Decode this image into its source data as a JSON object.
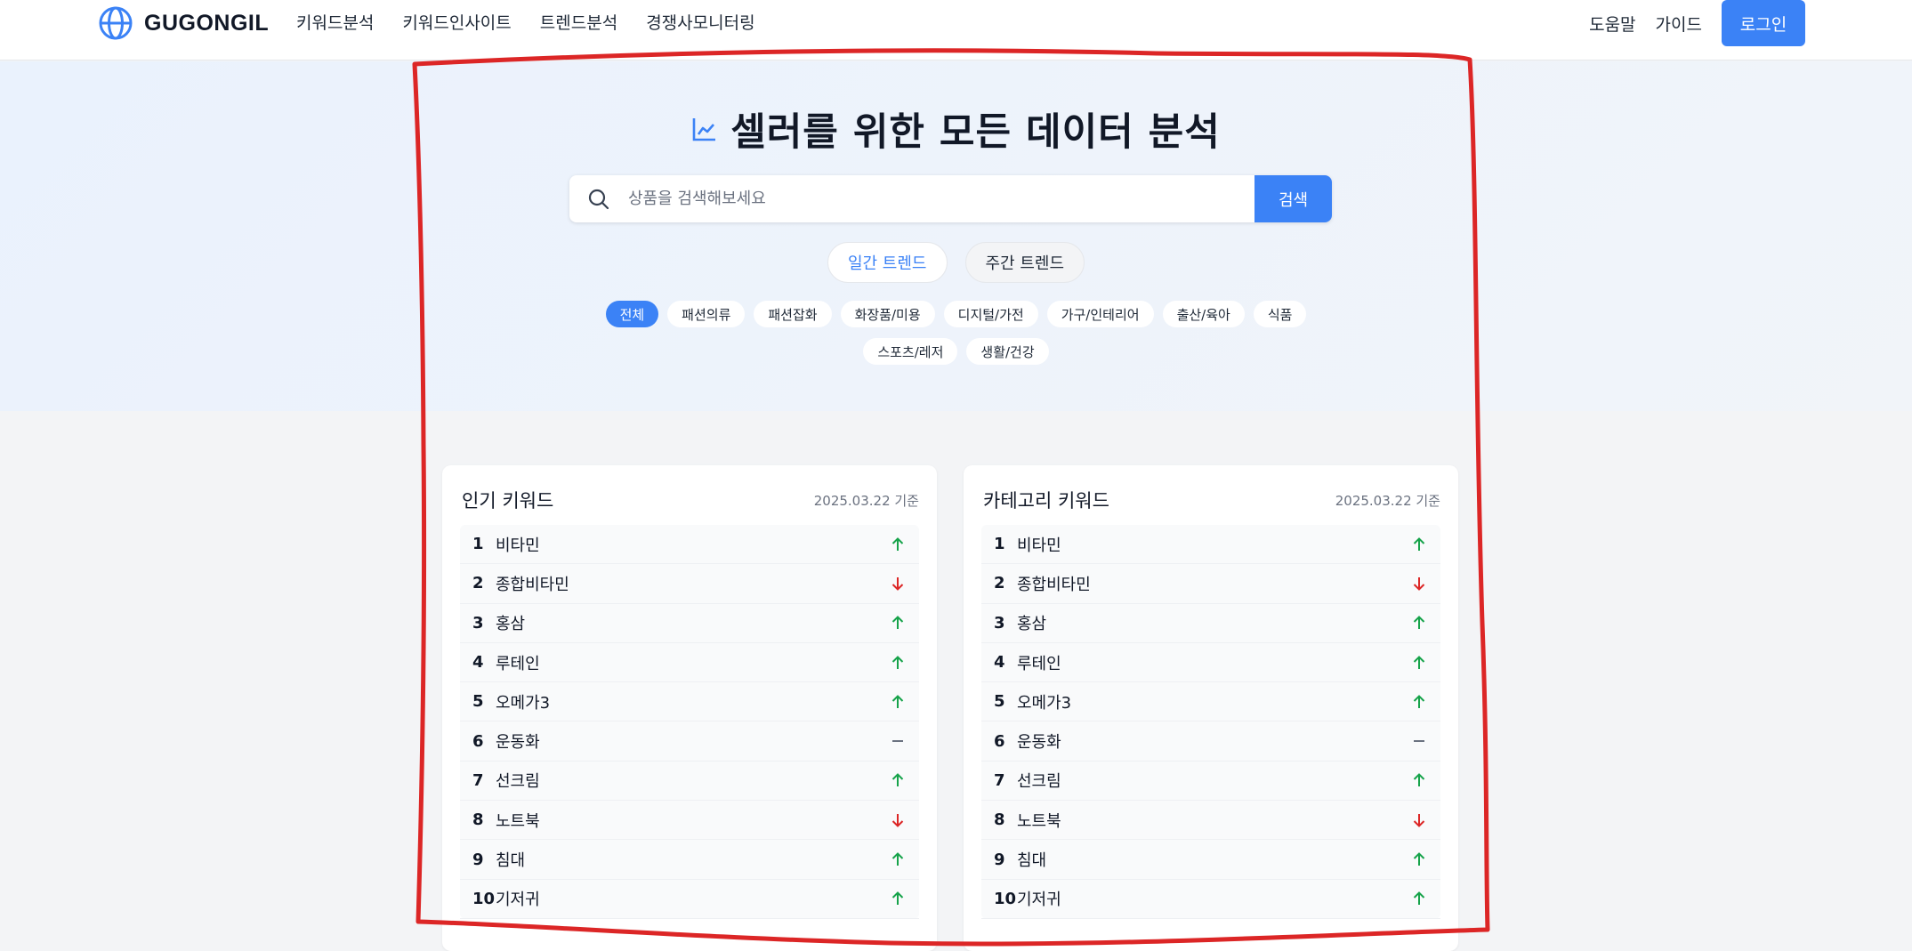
{
  "header": {
    "logo": "GUGONGIL",
    "nav": [
      "키워드분석",
      "키워드인사이트",
      "트렌드분석",
      "경쟁사모니터링"
    ],
    "help": "도움말",
    "guide": "가이드",
    "login": "로그인"
  },
  "hero": {
    "title": "셀러를 위한 모든 데이터 분석",
    "search_placeholder": "상품을 검색해보세요",
    "search_button": "검색",
    "trend_tabs": [
      "일간 트렌드",
      "주간 트렌드"
    ],
    "active_trend_tab": "일간 트렌드",
    "categories_row1": [
      "전체",
      "패션의류",
      "패션잡화",
      "화장품/미용",
      "디지털/가전",
      "가구/인테리어",
      "출산/육아",
      "식품"
    ],
    "categories_row2": [
      "스포츠/레저",
      "생활/건강"
    ],
    "active_category": "전체"
  },
  "cards": [
    {
      "title": "인기 키워드",
      "date": "2025.03.22 기준",
      "items": [
        {
          "rank": "1",
          "keyword": "비타민",
          "change": "up"
        },
        {
          "rank": "2",
          "keyword": "종합비타민",
          "change": "down"
        },
        {
          "rank": "3",
          "keyword": "홍삼",
          "change": "up"
        },
        {
          "rank": "4",
          "keyword": "루테인",
          "change": "up"
        },
        {
          "rank": "5",
          "keyword": "오메가3",
          "change": "up"
        },
        {
          "rank": "6",
          "keyword": "운동화",
          "change": "same"
        },
        {
          "rank": "7",
          "keyword": "선크림",
          "change": "up"
        },
        {
          "rank": "8",
          "keyword": "노트북",
          "change": "down"
        },
        {
          "rank": "9",
          "keyword": "침대",
          "change": "up"
        },
        {
          "rank": "10",
          "keyword": "기저귀",
          "change": "up"
        }
      ]
    },
    {
      "title": "카테고리 키워드",
      "date": "2025.03.22 기준",
      "items": [
        {
          "rank": "1",
          "keyword": "비타민",
          "change": "up"
        },
        {
          "rank": "2",
          "keyword": "종합비타민",
          "change": "down"
        },
        {
          "rank": "3",
          "keyword": "홍삼",
          "change": "up"
        },
        {
          "rank": "4",
          "keyword": "루테인",
          "change": "up"
        },
        {
          "rank": "5",
          "keyword": "오메가3",
          "change": "up"
        },
        {
          "rank": "6",
          "keyword": "운동화",
          "change": "same"
        },
        {
          "rank": "7",
          "keyword": "선크림",
          "change": "up"
        },
        {
          "rank": "8",
          "keyword": "노트북",
          "change": "down"
        },
        {
          "rank": "9",
          "keyword": "침대",
          "change": "up"
        },
        {
          "rank": "10",
          "keyword": "기저귀",
          "change": "up"
        }
      ]
    }
  ],
  "colors": {
    "accent": "#3b82f6",
    "up": "#16a34a",
    "down": "#dc2626",
    "same": "#6b7280",
    "annotation": "#dc2626"
  },
  "icons": {
    "logo": "globe-icon",
    "hero": "line-chart-icon",
    "search": "search-icon",
    "up": "arrow-up-icon",
    "down": "arrow-down-icon",
    "same": "dash-icon"
  }
}
